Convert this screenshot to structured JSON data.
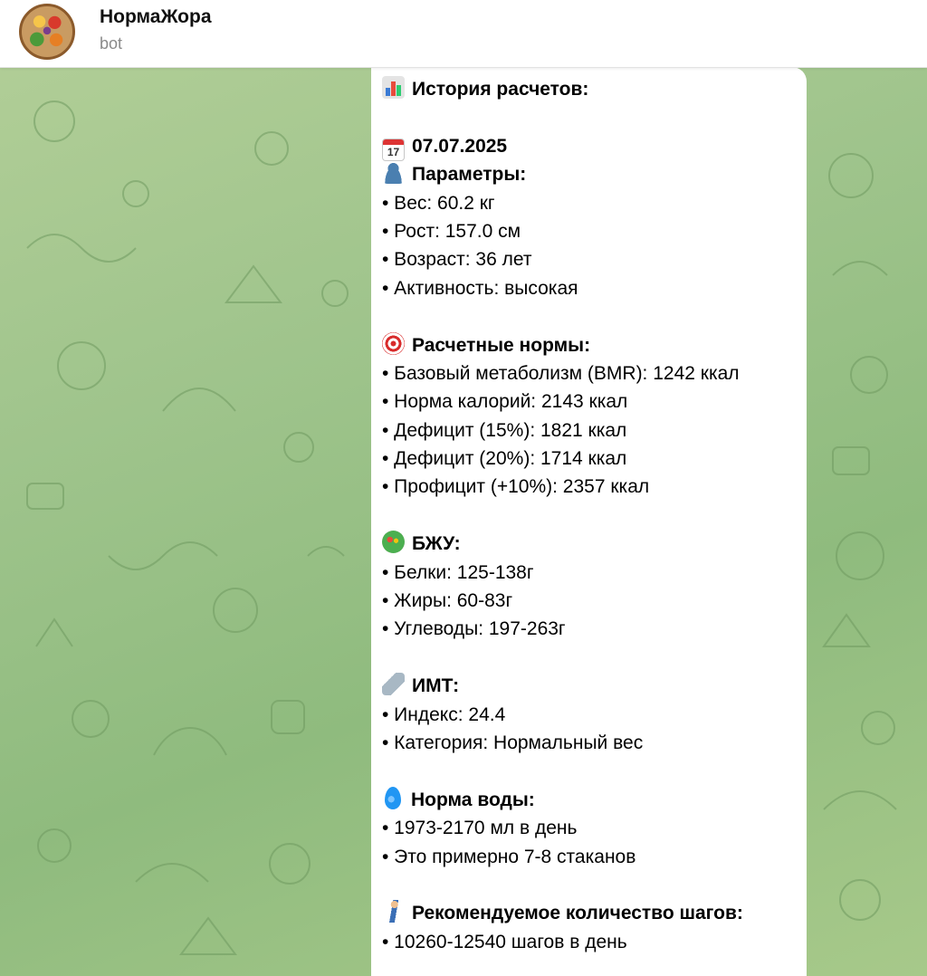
{
  "header": {
    "title": "НормаЖора",
    "subtitle": "bot"
  },
  "message": {
    "heading": "История расчетов:",
    "date": "07.07.2025",
    "sections": {
      "params": {
        "title": "Параметры:",
        "items": [
          "• Вес: 60.2 кг",
          "• Рост: 157.0 см",
          "• Возраст: 36 лет",
          "• Активность: высокая"
        ]
      },
      "norms": {
        "title": "Расчетные нормы:",
        "items": [
          "• Базовый метаболизм (BMR): 1242 ккал",
          "• Норма калорий: 2143 ккал",
          "• Дефицит (15%): 1821 ккал",
          "• Дефицит (20%): 1714 ккал",
          "• Профицит (+10%): 2357 ккал"
        ]
      },
      "macros": {
        "title": "БЖУ:",
        "items": [
          "• Белки: 125-138г",
          "• Жиры: 60-83г",
          "• Углеводы: 197-263г"
        ]
      },
      "bmi": {
        "title": "ИМТ:",
        "items": [
          "• Индекс: 24.4",
          "• Категория: Нормальный вес"
        ]
      },
      "water": {
        "title": "Норма воды:",
        "items": [
          "• 1973-2170 мл в день",
          "• Это примерно 7-8 стаканов"
        ]
      },
      "steps": {
        "title": "Рекомендуемое количество шагов:",
        "items": [
          "• 10260-12540 шагов в день"
        ]
      }
    },
    "calendar_day": "17"
  },
  "icons": {
    "heading": "bar-chart-icon",
    "date": "calendar-icon",
    "params": "person-icon",
    "norms": "target-icon",
    "macros": "salad-icon",
    "bmi": "ruler-icon",
    "water": "droplet-icon",
    "steps": "walking-person-icon"
  },
  "colors": {
    "background": "#9fc48c",
    "bubble": "#ffffff",
    "header": "#ffffff",
    "subtitle": "#8a8a8a"
  }
}
